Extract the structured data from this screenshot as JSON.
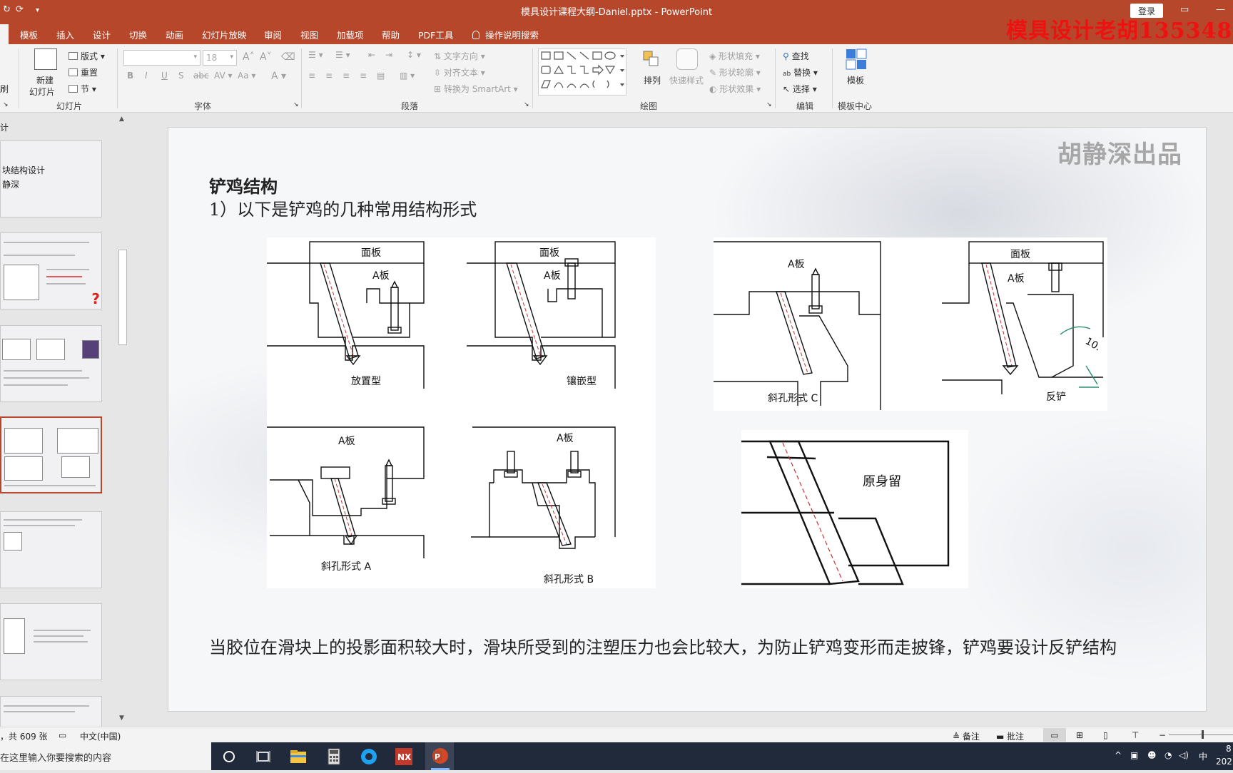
{
  "titlebar": {
    "doc_title": "模具设计课程大纲-Daniel.pptx  -  PowerPoint",
    "login": "登录",
    "overlay_watermark": "模具设计老胡1353488"
  },
  "tabs": [
    "模板",
    "插入",
    "设计",
    "切换",
    "动画",
    "幻灯片放映",
    "审阅",
    "视图",
    "加载项",
    "帮助",
    "PDF工具",
    "操作说明搜索"
  ],
  "ribbon": {
    "slides_group": {
      "new_slide": "新建",
      "new_slide2": "幻灯片",
      "layout": "版式",
      "reset": "重置",
      "section": "节",
      "label": "幻灯片",
      "clip_partial": "刷"
    },
    "font_group": {
      "font_size": "18",
      "label": "字体"
    },
    "paragraph_group": {
      "text_direction": "文字方向",
      "align_text": "对齐文本",
      "smartart": "转换为 SmartArt",
      "label": "段落"
    },
    "drawing_group": {
      "arrange": "排列",
      "quick_styles": "快速样式",
      "shape_fill": "形状填充",
      "shape_outline": "形状轮廓",
      "shape_effects": "形状效果",
      "label": "绘图"
    },
    "editing_group": {
      "find": "查找",
      "replace": "替换",
      "select": "选择",
      "label": "编辑"
    },
    "template_group": {
      "template": "模板",
      "label": "模板中心"
    }
  },
  "panel": {
    "section_title": "计",
    "thumb1_lines": [
      "块结构设计",
      "静深"
    ]
  },
  "slide": {
    "author_mark": "胡静深出品",
    "heading": "铲鸡结构",
    "subheading": "1）以下是铲鸡的几种常用结构形式",
    "body": "当胶位在滑块上的投影面积较大时，滑块所受到的注塑压力也会比较大，为防止铲鸡变形而走披锋，铲鸡要设计反铲结构",
    "figures": {
      "face_plate": "面板",
      "a_plate": "A板",
      "type1": "放置型",
      "type2": "镶嵌型",
      "typeC": "斜孔形式 C",
      "reverse": "反铲",
      "angle": "10.",
      "typeA": "斜孔形式 A",
      "typeB": "斜孔形式 B",
      "original": "原身留"
    }
  },
  "status": {
    "slide_count": "，共 609 张",
    "language": "中文(中国)",
    "notes": "备注",
    "comments": "批注"
  },
  "taskbar": {
    "search_placeholder": "在这里输入你要搜索的内容",
    "ime": "中",
    "clock_partial": "8",
    "date_partial": "202"
  }
}
